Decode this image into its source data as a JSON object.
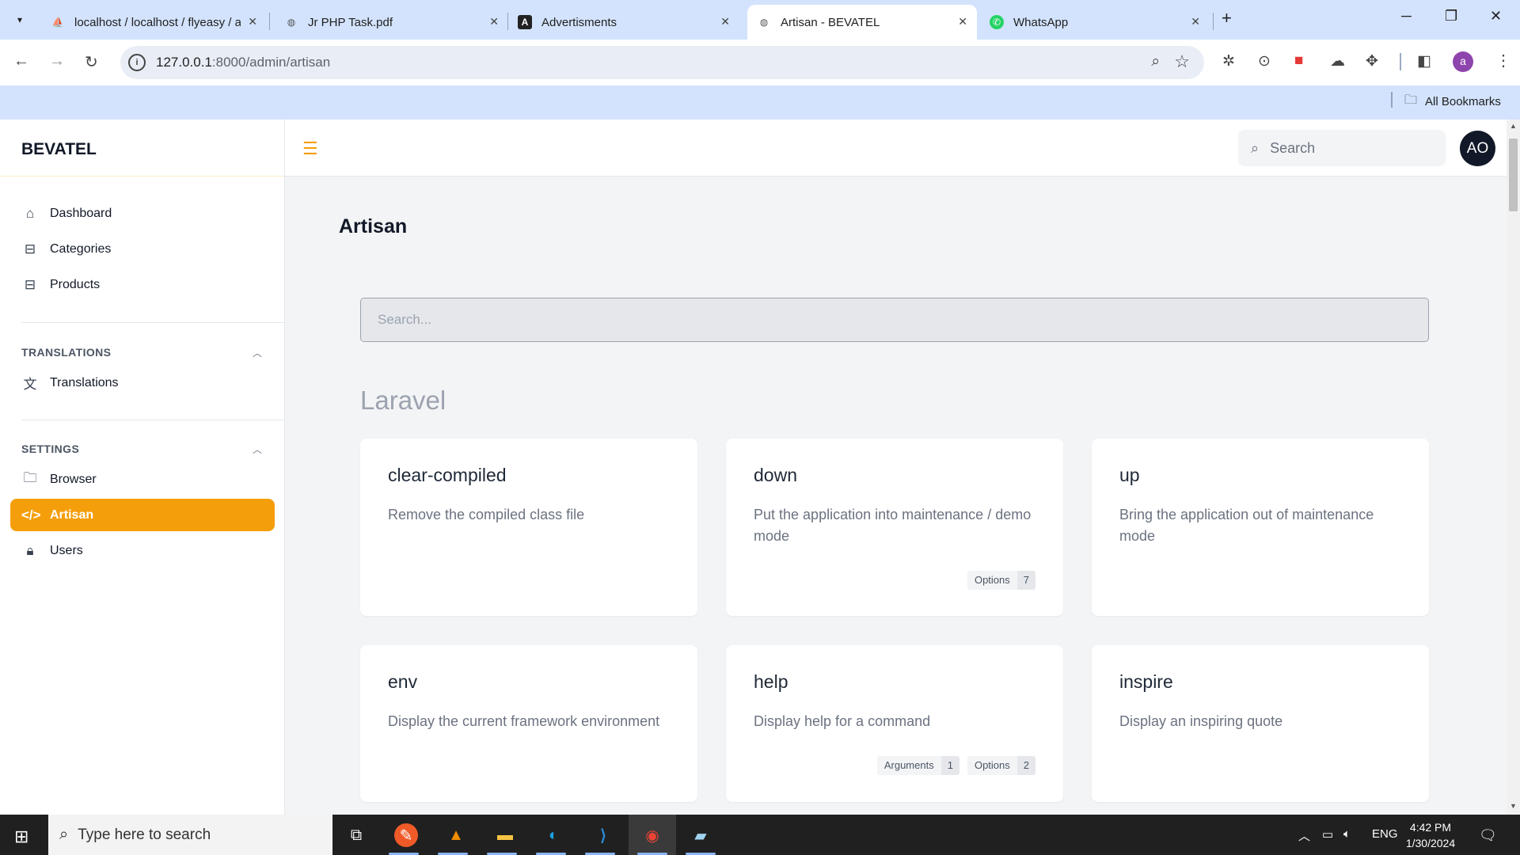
{
  "browser": {
    "tabs": [
      {
        "title": "localhost / localhost / flyeasy / a",
        "favicon": "phpmyadmin-icon"
      },
      {
        "title": "Jr PHP Task.pdf",
        "favicon": "globe-icon"
      },
      {
        "title": "Advertisments",
        "favicon": "a-logo-icon"
      },
      {
        "title": "Artisan - BEVATEL",
        "favicon": "globe-icon",
        "active": true
      },
      {
        "title": "WhatsApp",
        "favicon": "whatsapp-icon"
      }
    ],
    "url_host": "127.0.0.1",
    "url_path": ":8000/admin/artisan",
    "bookmarks_label": "All Bookmarks",
    "profile_initial": "a"
  },
  "app": {
    "brand": "BEVATEL",
    "accent_color": "#f59e0b",
    "nav": [
      {
        "label": "Dashboard",
        "icon": "home-icon"
      },
      {
        "label": "Categories",
        "icon": "shopping-bag-icon"
      },
      {
        "label": "Products",
        "icon": "shopping-bag-icon"
      }
    ],
    "translations_section": {
      "title": "TRANSLATIONS",
      "items": [
        {
          "label": "Translations",
          "icon": "language-icon"
        }
      ]
    },
    "settings_section": {
      "title": "SETTINGS",
      "items": [
        {
          "label": "Browser",
          "icon": "folder-icon"
        },
        {
          "label": "Artisan",
          "icon": "code-icon",
          "active": true
        },
        {
          "label": "Users",
          "icon": "lock-icon"
        }
      ]
    },
    "top_search_placeholder": "Search",
    "avatar_initials": "AO"
  },
  "page": {
    "title": "Artisan",
    "search_placeholder": "Search...",
    "group_title": "Laravel",
    "commands": [
      {
        "name": "clear-compiled",
        "description": "Remove the compiled class file",
        "badges": []
      },
      {
        "name": "down",
        "description": "Put the application into maintenance / demo mode",
        "badges": [
          {
            "label": "Options",
            "value": "7"
          }
        ]
      },
      {
        "name": "up",
        "description": "Bring the application out of maintenance mode",
        "badges": []
      },
      {
        "name": "env",
        "description": "Display the current framework environment",
        "badges": []
      },
      {
        "name": "help",
        "description": "Display help for a command",
        "badges": [
          {
            "label": "Arguments",
            "value": "1"
          },
          {
            "label": "Options",
            "value": "2"
          }
        ]
      },
      {
        "name": "inspire",
        "description": "Display an inspiring quote",
        "badges": []
      }
    ]
  },
  "taskbar": {
    "search_placeholder": "Type here to search",
    "language": "ENG",
    "time": "4:42 PM",
    "date": "1/30/2024"
  }
}
